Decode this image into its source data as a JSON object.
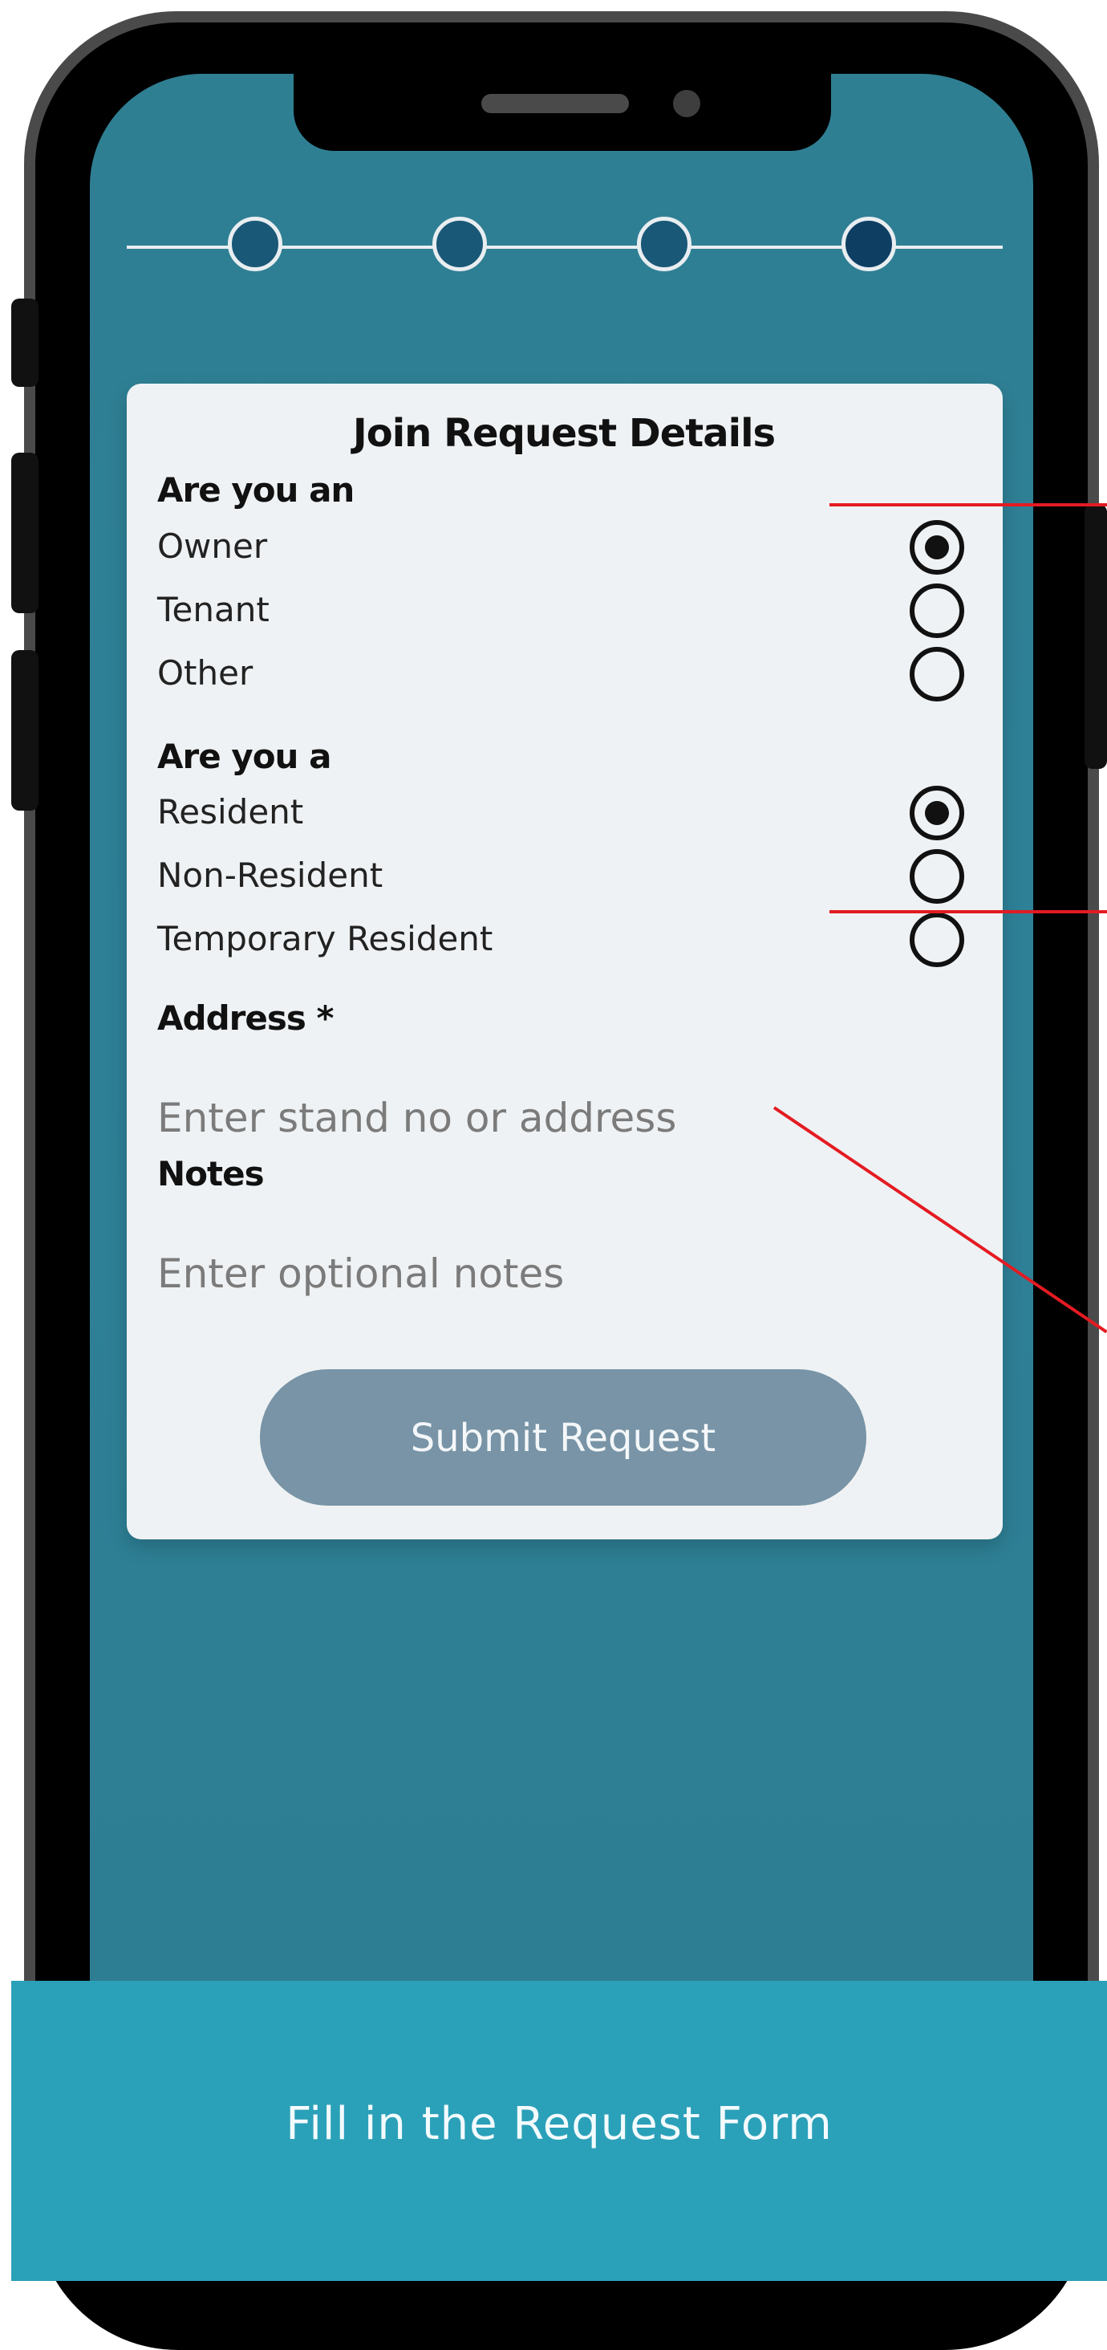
{
  "form": {
    "title": "Join Request Details",
    "role_question": "Are you an",
    "role_options": [
      {
        "label": "Owner",
        "selected": true
      },
      {
        "label": "Tenant",
        "selected": false
      },
      {
        "label": "Other",
        "selected": false
      }
    ],
    "residency_question": "Are you a",
    "residency_options": [
      {
        "label": "Resident",
        "selected": true
      },
      {
        "label": "Non-Resident",
        "selected": false
      },
      {
        "label": "Temporary Resident",
        "selected": false
      }
    ],
    "address_label": "Address *",
    "address_placeholder": "Enter stand no or address",
    "notes_label": "Notes",
    "notes_placeholder": "Enter optional notes",
    "submit_label": "Submit Request"
  },
  "stepper": {
    "total_steps": 4,
    "current_step": 4
  },
  "banner": {
    "caption": "Fill in the Request Form"
  },
  "colors": {
    "screen": "#2f7f93",
    "card": "#eff2f4",
    "button": "#7894a6",
    "banner": "#2ba0b9",
    "callout": "#e41b22"
  }
}
